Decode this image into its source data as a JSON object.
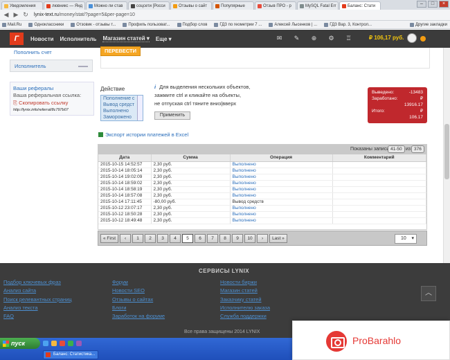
{
  "browser": {
    "tabs": [
      {
        "label": "Уведомления",
        "color": "#f5b942",
        "active": false
      },
      {
        "label": "лювникс — Янд",
        "color": "#e23b1b",
        "active": false
      },
      {
        "label": "Можно ли став",
        "color": "#4a90d9",
        "active": false
      },
      {
        "label": "соцсети [Росси",
        "color": "#444444",
        "active": false
      },
      {
        "label": "Отзывы о сайт",
        "color": "#f39c12",
        "active": false
      },
      {
        "label": "Популярные",
        "color": "#d35400",
        "active": false
      },
      {
        "label": "Отзыв ПРО - р",
        "color": "#e74c3c",
        "active": false
      },
      {
        "label": "MySQL Fatal Err",
        "color": "#7f8c8d",
        "active": false
      },
      {
        "label": "Баланс: Стати",
        "color": "#e23b1b",
        "active": true
      }
    ],
    "url_domain": "lynix-text.ru",
    "url_path": "/money/stat/?page=5&per-page=10",
    "bookmarks": [
      "Mail.Ru",
      "Одноклассники",
      "Отзовик - отзывы т...",
      "Профиль пользоват...",
      "Подбор слов",
      "ГДЗ по геометрии 7 ...",
      "Алексей Лысенков | ...",
      "ГДЗ Вар. 3, Контрол..."
    ],
    "bookmarks_right": "Другие закладки"
  },
  "topnav": {
    "logo": "Г",
    "items": [
      "Новости",
      "Исполнитель",
      "Магазин статей",
      "Еще"
    ],
    "icons": [
      "mail-icon",
      "pencil-icon",
      "plus-icon",
      "gear-icon",
      "cart-icon"
    ],
    "balance": "₽ 106,17 руб."
  },
  "sidebar": {
    "top_link": "Пополнить счет",
    "active_item": "Исполнитель",
    "referrals_title": "Ваши рефералы",
    "referral_label": "Ваша реферальная ссылка:",
    "copy_link": "Скопировать ссылку",
    "referral_url": "http://lynix.info/referral/8c797b07"
  },
  "actions": {
    "transfer_button": "ПЕРЕВЕСТИ",
    "action_label": "Действие",
    "list_options": [
      "Пополнение с",
      "Вывод средст",
      "Выполнено",
      "Заморожено"
    ],
    "info_lines": [
      "Для выделения нескольких объектов,",
      "зажмите ctrl и кликайте на объекты,",
      "не отпуская ctrl тяните вниз|вверх"
    ],
    "apply_button": "Применить"
  },
  "stats": {
    "withdrawn_label": "Выведено:",
    "withdrawn_value": "-13483",
    "earned_label": "Заработано:",
    "earned_value": "13916.17",
    "total_label": "Итого:",
    "total_value": "106.17",
    "currency": "₽"
  },
  "export_label": "Экспорт истории платежей в Excel",
  "table": {
    "shown_label": "Показаны записи",
    "range": "41-50",
    "of_label": "из",
    "total": "376",
    "columns": [
      "Дата",
      "Сумма",
      "Операция",
      "Комментарий"
    ],
    "rows": [
      {
        "date": "2015-10-15 14:52:57",
        "sum": "2,30 руб.",
        "op": "Выполнено",
        "comment": ""
      },
      {
        "date": "2015-10-14 18:05:14",
        "sum": "2,30 руб.",
        "op": "Выполнено",
        "comment": ""
      },
      {
        "date": "2015-10-14 19:02:09",
        "sum": "2,30 руб.",
        "op": "Выполнено",
        "comment": ""
      },
      {
        "date": "2015-10-14 18:59:02",
        "sum": "2,30 руб.",
        "op": "Выполнено",
        "comment": ""
      },
      {
        "date": "2015-10-14 18:58:19",
        "sum": "2,30 руб.",
        "op": "Выполнено",
        "comment": ""
      },
      {
        "date": "2015-10-14 18:57:08",
        "sum": "2,30 руб.",
        "op": "Выполнено",
        "comment": ""
      },
      {
        "date": "2015-10-14 17:11:45",
        "sum": "-80,00 руб.",
        "op": "Вывод средств",
        "comment": ""
      },
      {
        "date": "2015-10-12 23:07:17",
        "sum": "2,30 руб.",
        "op": "Выполнено",
        "comment": ""
      },
      {
        "date": "2015-10-12 18:50:28",
        "sum": "2,30 руб.",
        "op": "Выполнено",
        "comment": ""
      },
      {
        "date": "2015-10-12 18:49:48",
        "sum": "2,30 руб.",
        "op": "Выполнено",
        "comment": ""
      }
    ]
  },
  "pager": {
    "first": "« First",
    "prev": "‹",
    "pages": [
      "1",
      "2",
      "3",
      "4",
      "5",
      "6",
      "7",
      "8",
      "9",
      "10"
    ],
    "current": "5",
    "next": "›",
    "last": "Last »",
    "per_page": "10"
  },
  "footer": {
    "title": "СЕРВИСЫ LYNIX",
    "col1": [
      "Подбор ключевых фраз",
      "Анализ сайта",
      "Поиск релевантных страниц",
      "Анализ текста",
      "FAQ"
    ],
    "col2": [
      "Форум",
      "Новости SEO",
      "Отзывы о сайтах",
      "Блоги",
      "Заработок на форуме"
    ],
    "col3": [
      "Новости биржи",
      "Магазин статей",
      "Заказчику статей",
      "Исполнителю заказа",
      "Служба поддержки"
    ],
    "copyright": "Все права защищены 2014 LYNIX"
  },
  "taskbar": {
    "start": "пуск",
    "task": "Баланс: Статистика..."
  },
  "watermark": {
    "text": "ProBarahlo"
  }
}
